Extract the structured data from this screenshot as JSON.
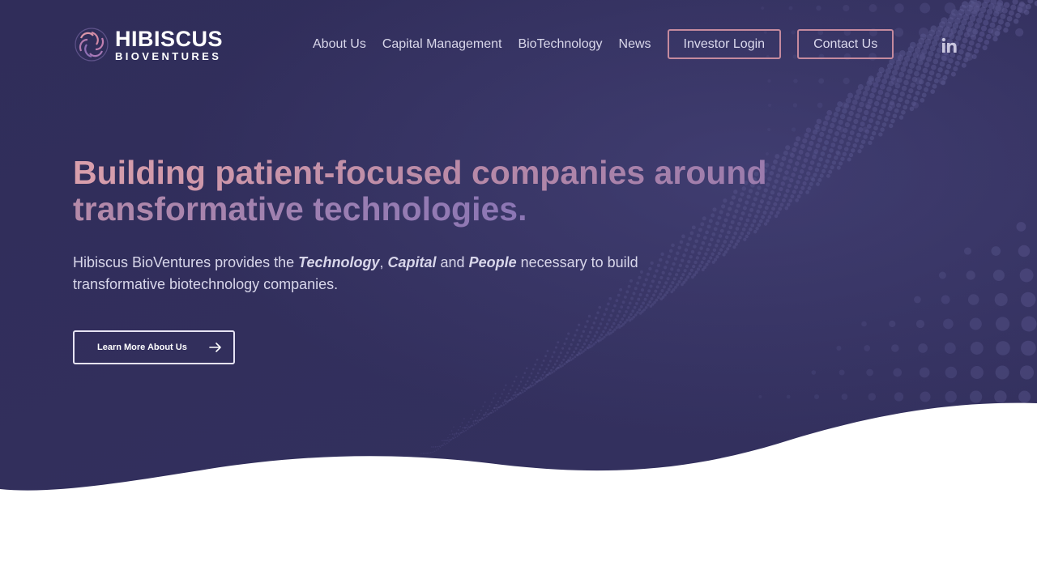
{
  "brand": {
    "name": "HIBISCUS",
    "subname": "BIOVENTURES",
    "logo_icon": "hibiscus-flower-icon"
  },
  "nav": {
    "links": [
      "About Us",
      "Capital Management",
      "BioTechnology",
      "News"
    ],
    "investor_login": "Investor Login",
    "contact_us": "Contact Us",
    "social_icon": "linkedin-icon"
  },
  "hero": {
    "headline_line1": "Building patient-focused companies around",
    "headline_line2": "transformative technologies.",
    "sub_prefix": "Hibiscus BioVentures provides the ",
    "sub_tech": "Technology",
    "sub_comma": ", ",
    "sub_capital": "Capital",
    "sub_and": " and ",
    "sub_people": "People",
    "sub_suffix": " necessary to build transformative biotechnology companies.",
    "cta_label": "Learn More About Us",
    "cta_icon": "arrow-right-icon"
  },
  "colors": {
    "hero_bg": "#322f5b",
    "accent_pink": "#c58a9e",
    "dots": "#5c5991"
  }
}
